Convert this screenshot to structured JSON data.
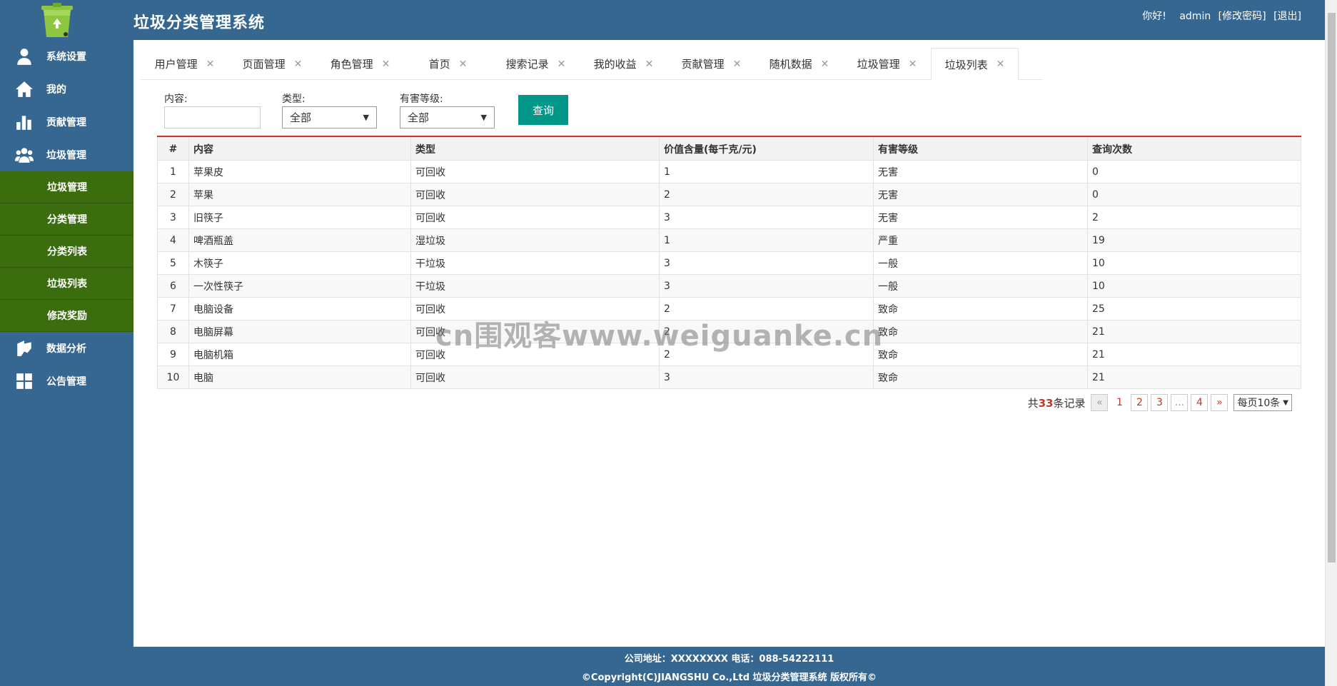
{
  "app": {
    "title": "垃圾分类管理系统",
    "greeting": "你好!",
    "username": "admin",
    "change_password": "[修改密码]",
    "logout": "[退出]"
  },
  "sidebar": {
    "items": [
      {
        "label": "系统设置",
        "icon": "user-icon"
      },
      {
        "label": "我的",
        "icon": "home-icon"
      },
      {
        "label": "贡献管理",
        "icon": "bar-chart-icon"
      },
      {
        "label": "垃圾管理",
        "icon": "users-icon"
      }
    ],
    "sub_items": [
      "垃圾管理",
      "分类管理",
      "分类列表",
      "垃圾列表",
      "修改奖励"
    ],
    "bottom_items": [
      {
        "label": "数据分析",
        "icon": "analytics-icon"
      },
      {
        "label": "公告管理",
        "icon": "grid-icon"
      }
    ]
  },
  "tabs": [
    {
      "label": "用户管理",
      "active": false
    },
    {
      "label": "页面管理",
      "active": false
    },
    {
      "label": "角色管理",
      "active": false
    },
    {
      "label": "首页",
      "active": false
    },
    {
      "label": "搜索记录",
      "active": false
    },
    {
      "label": "我的收益",
      "active": false
    },
    {
      "label": "贡献管理",
      "active": false
    },
    {
      "label": "随机数据",
      "active": false
    },
    {
      "label": "垃圾管理",
      "active": false
    },
    {
      "label": "垃圾列表",
      "active": true
    }
  ],
  "filter": {
    "content_label": "内容:",
    "content_value": "",
    "type_label": "类型:",
    "type_value": "全部",
    "level_label": "有害等级:",
    "level_value": "全部",
    "query_button": "查询"
  },
  "table": {
    "headers": [
      "#",
      "内容",
      "类型",
      "价值含量(每千克/元)",
      "有害等级",
      "查询次数"
    ],
    "rows": [
      [
        "1",
        "苹果皮",
        "可回收",
        "1",
        "无害",
        "0"
      ],
      [
        "2",
        "苹果",
        "可回收",
        "2",
        "无害",
        "0"
      ],
      [
        "3",
        "旧筷子",
        "可回收",
        "3",
        "无害",
        "2"
      ],
      [
        "4",
        "啤酒瓶盖",
        "湿垃圾",
        "1",
        "严重",
        "19"
      ],
      [
        "5",
        "木筷子",
        "干垃圾",
        "3",
        "一般",
        "10"
      ],
      [
        "6",
        "一次性筷子",
        "干垃圾",
        "3",
        "一般",
        "10"
      ],
      [
        "7",
        "电脑设备",
        "可回收",
        "2",
        "致命",
        "25"
      ],
      [
        "8",
        "电脑屏幕",
        "可回收",
        "2",
        "致命",
        "21"
      ],
      [
        "9",
        "电脑机箱",
        "可回收",
        "2",
        "致命",
        "21"
      ],
      [
        "10",
        "电脑",
        "可回收",
        "3",
        "致命",
        "21"
      ]
    ]
  },
  "pager": {
    "total_prefix": "共",
    "total_count": "33",
    "total_suffix": "条记录",
    "prev": "«",
    "pages": [
      "1",
      "2",
      "3",
      "...",
      "4"
    ],
    "next": "»",
    "page_size": "每页10条"
  },
  "footer": {
    "line1": "公司地址：XXXXXXXX 电话：088-54222111",
    "line2": "©Copyright(C)JIANGSHU Co.,Ltd 垃圾分类管理系统 版权所有©"
  },
  "watermark": "cn围观客www.weiguanke.cn",
  "colors": {
    "primary": "#366790",
    "submenu": "#3b6d0f",
    "accent": "#009688",
    "danger": "#c0392b"
  }
}
